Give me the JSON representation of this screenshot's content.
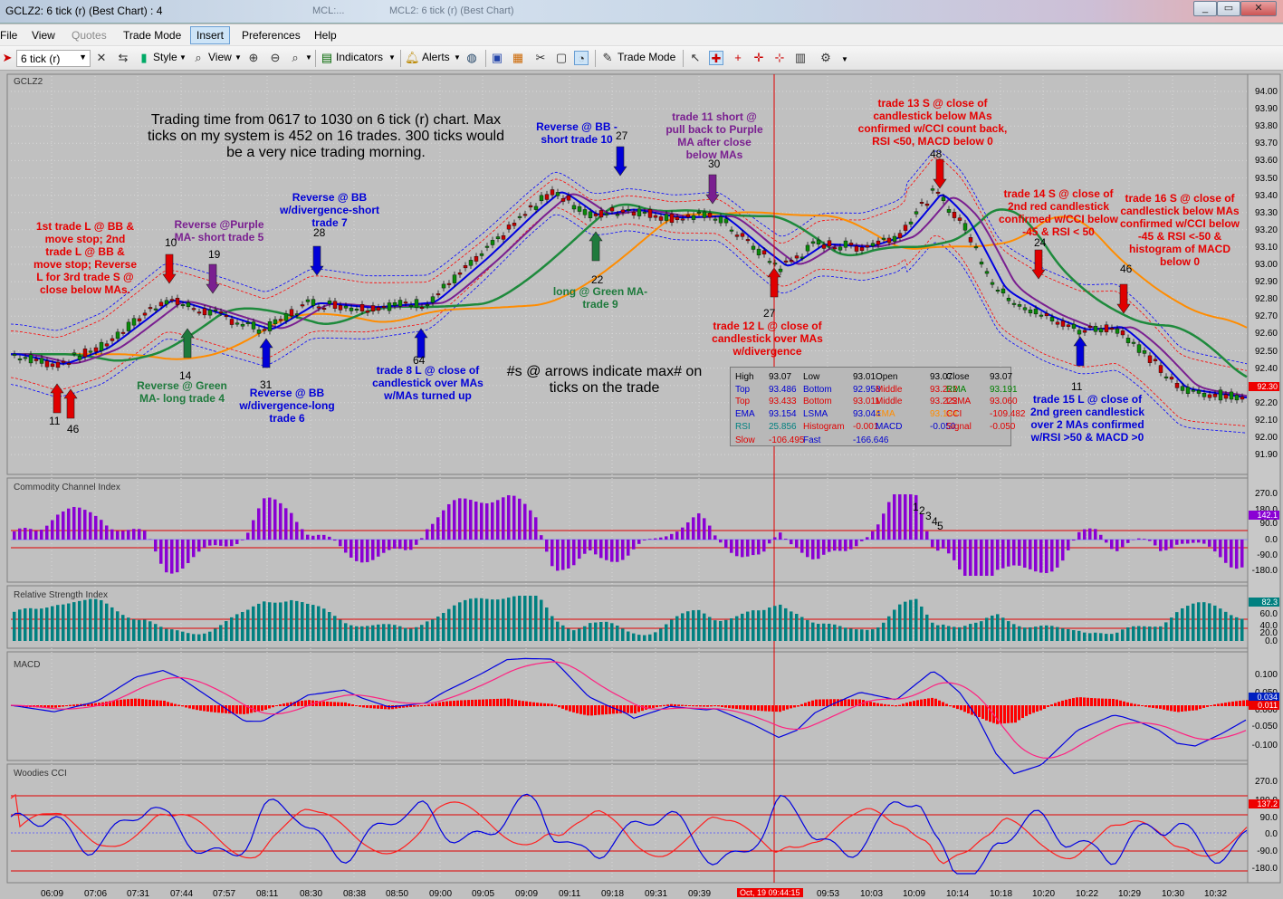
{
  "window": {
    "title": "GCLZ2: 6 tick (r) (Best Chart) : 4",
    "ghost_tabs": [
      "MCL:...",
      "MCL2: 6 tick (r) (Best Chart)"
    ]
  },
  "menu": {
    "items": [
      {
        "label": "File",
        "enabled": true
      },
      {
        "label": "View",
        "enabled": true
      },
      {
        "label": "Quotes",
        "enabled": false
      },
      {
        "label": "Trade Mode",
        "enabled": true
      },
      {
        "label": "Insert",
        "enabled": true,
        "active": true
      },
      {
        "label": "Preferences",
        "enabled": true
      },
      {
        "label": "Help",
        "enabled": true
      }
    ]
  },
  "toolbar": {
    "interval_select": "6 tick (r)",
    "style_label": "Style",
    "view_label": "View",
    "indicators_label": "Indicators",
    "alerts_label": "Alerts",
    "trade_mode_label": "Trade Mode"
  },
  "chart": {
    "symbol": "GCLZ2",
    "price_axis": [
      "94.00",
      "93.90",
      "93.80",
      "93.70",
      "93.60",
      "93.50",
      "93.40",
      "93.30",
      "93.20",
      "93.10",
      "93.00",
      "92.90",
      "92.80",
      "92.70",
      "92.60",
      "92.50",
      "92.40",
      "92.30",
      "92.20",
      "92.10",
      "92.00",
      "91.90"
    ],
    "price_badge": "92.30",
    "time_axis": [
      "06:09",
      "07:06",
      "07:31",
      "07:44",
      "07:57",
      "08:11",
      "08:30",
      "08:38",
      "08:50",
      "09:00",
      "09:05",
      "09:09",
      "09:11",
      "09:18",
      "09:31",
      "09:39",
      "09:53",
      "10:03",
      "10:09",
      "10:14",
      "10:18",
      "10:20",
      "10:22",
      "10:29",
      "10:30",
      "10:32"
    ],
    "cursor_time": "Oct, 19 09:44:15",
    "notes": {
      "header": "Trading time from 0617 to 1030 on 6 tick (r) chart. Max ticks on my system is 452 on 16 trades. 300 ticks would be a very nice trading morning.",
      "arrows": "#s @ arrows indicate max# on ticks on the trade"
    },
    "annotations": [
      {
        "text": "1st trade L @ BB & move stop; 2nd trade L @ BB & move stop; Reverse L for 3rd trade S @ close below MAs.",
        "color": "red"
      },
      {
        "text": "Reverse @Purple MA- short trade 5",
        "color": "purple"
      },
      {
        "text": "Reverse @ Green MA- long trade 4",
        "color": "green"
      },
      {
        "text": "Reverse @ BB w/divergence-long trade 6",
        "color": "blue"
      },
      {
        "text": "Reverse @ BB w/divergence-short trade 7",
        "color": "blue"
      },
      {
        "text": "trade 8 L @ close of candlestick over MAs w/MAs turned up",
        "color": "blue"
      },
      {
        "text": "Reverse @ BB - short trade 10",
        "color": "blue"
      },
      {
        "text": "long @ Green MA- trade 9",
        "color": "green"
      },
      {
        "text": "trade 11 short @ pull back to Purple MA after close below MAs",
        "color": "purple"
      },
      {
        "text": "trade 12 L @ close of candlestick over MAs w/divergence",
        "color": "red"
      },
      {
        "text": "trade 13 S @ close of candlestick below MAs confirmed w/CCI count back, RSI <50, MACD below 0",
        "color": "red"
      },
      {
        "text": "trade 14 S @ close of 2nd red candlestick confirmed w/CCI below -45 & RSI < 50",
        "color": "red"
      },
      {
        "text": "trade 16 S @ close of candlestick below MAs confirmed w/CCI below -45 & RSI <-50 & histogram of MACD below 0",
        "color": "red"
      },
      {
        "text": "trade 15 L @ close of 2nd green candlestick over 2 MAs confirmed w/RSI >50 & MACD >0",
        "color": "blue"
      }
    ],
    "arrow_numbers": [
      "11",
      "46",
      "10",
      "19",
      "14",
      "31",
      "28",
      "64",
      "22",
      "27",
      "30",
      "27",
      "48",
      "24",
      "11",
      "46"
    ],
    "cci_count": [
      "1",
      "2",
      "3",
      "4",
      "5"
    ]
  },
  "databox": {
    "rows": [
      [
        [
          "High",
          "93.07"
        ],
        [
          "Low",
          "93.01"
        ],
        [
          "Open",
          "93.07"
        ],
        [
          "Close",
          "93.07"
        ]
      ],
      [
        [
          "Top",
          "93.486"
        ],
        [
          "Bottom",
          "92.958"
        ],
        [
          "Middle",
          "93.222"
        ],
        [
          "RMA",
          "93.191"
        ]
      ],
      [
        [
          "Top",
          "93.433"
        ],
        [
          "Bottom",
          "93.011"
        ],
        [
          "Middle",
          "93.222"
        ],
        [
          "LSMA",
          "93.060"
        ]
      ],
      [
        [
          "EMA",
          "93.154"
        ],
        [
          "LSMA",
          "93.044"
        ],
        [
          "EMA",
          "93.184"
        ],
        [
          "CCI",
          "-109.482"
        ]
      ],
      [
        [
          "RSI",
          "25.856"
        ],
        [
          "Histogram",
          "-0.001"
        ],
        [
          "MACD",
          "-0.050"
        ],
        [
          "Signal",
          "-0.050"
        ]
      ],
      [
        [
          "Slow",
          "-106.495"
        ],
        [
          "Fast",
          "-166.646"
        ]
      ]
    ]
  },
  "panels": {
    "cci": {
      "title": "Commodity Channel Index",
      "axis": [
        "270.0",
        "180.0",
        "90.0",
        "0.0",
        "-90.0",
        "-180.0"
      ],
      "badge": "142.1"
    },
    "rsi": {
      "title": "Relative Strength Index",
      "axis": [
        "100.0",
        "60.0",
        "40.0",
        "20.0",
        "0.0"
      ],
      "badge": "82.3"
    },
    "macd": {
      "title": "MACD",
      "axis": [
        "0.100",
        "0.050",
        "0.000",
        "-0.050",
        "-0.100"
      ],
      "badge_macd": "0.034",
      "badge_hist": "0.011"
    },
    "woodies": {
      "title": "Woodies CCI",
      "axis": [
        "270.0",
        "180.0",
        "90.0",
        "0.0",
        "-90.0",
        "-180.0"
      ],
      "badge": "137.2"
    }
  },
  "colors": {
    "bb_outer": "#0000ff",
    "bb_inner": "#ff0000",
    "ma_blue": "#0000e0",
    "ma_purple": "#7a1f90",
    "ma_green": "#1e8a3c",
    "ma_orange": "#ff8c00",
    "cci_bar": "#8a00d4",
    "rsi_bar": "#008080",
    "macd_hist": "#ff0000",
    "candle_up": "#0a8a0a",
    "candle_down": "#c80000"
  }
}
